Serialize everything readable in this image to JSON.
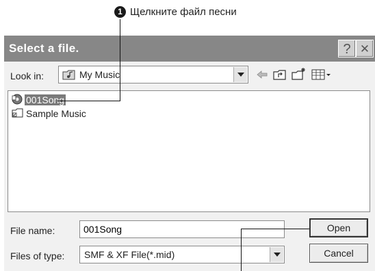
{
  "callout": {
    "number": "1",
    "text": "Щелкните файл песни"
  },
  "dialog": {
    "title": "Select a file.",
    "help_button": "?",
    "close_button": "✕",
    "look_in_label": "Look in:",
    "look_in_value": "My Music",
    "files": [
      {
        "name": "001Song",
        "icon": "audio-file-icon",
        "selected": true
      },
      {
        "name": "Sample Music",
        "icon": "folder-shortcut-icon",
        "selected": false
      }
    ],
    "file_name_label": "File name:",
    "file_name_value": "001Song",
    "files_of_type_label": "Files of type:",
    "files_of_type_value": "SMF & XF File(*.mid)",
    "open_label": "Open",
    "cancel_label": "Cancel"
  },
  "colors": {
    "titlebar": "#878787",
    "selection": "#7a7a7a",
    "dialog_bg": "#f1f1f1"
  }
}
